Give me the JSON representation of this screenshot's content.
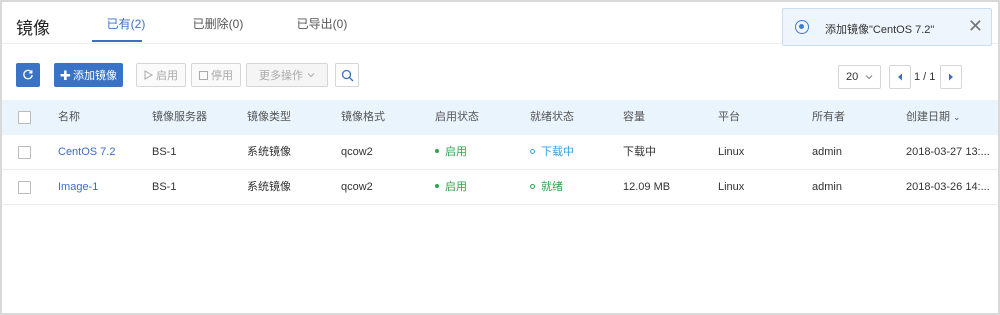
{
  "page": {
    "title": "镜像"
  },
  "tabs": [
    {
      "label": "已有(2)",
      "active": true
    },
    {
      "label": "已删除(0)",
      "active": false
    },
    {
      "label": "已导出(0)",
      "active": false
    }
  ],
  "notification": {
    "text": "添加镜像\"CentOS 7.2\"",
    "close": "✕"
  },
  "toolbar": {
    "add_label": "添加镜像",
    "enable_label": "启用",
    "disable_label": "停用",
    "more_label": "更多操作"
  },
  "pagination": {
    "page_size": "20",
    "page_info": "1 / 1"
  },
  "table": {
    "headers": [
      "名称",
      "镜像服务器",
      "镜像类型",
      "镜像格式",
      "启用状态",
      "就绪状态",
      "容量",
      "平台",
      "所有者",
      "创建日期"
    ],
    "rows": [
      {
        "name": "CentOS 7.2",
        "server": "BS-1",
        "type": "系统镜像",
        "format": "qcow2",
        "enable_state": "启用",
        "ready_state": "下载中",
        "size": "下载中",
        "platform": "Linux",
        "owner": "admin",
        "created": "2018-03-27 13:..."
      },
      {
        "name": "Image-1",
        "server": "BS-1",
        "type": "系统镜像",
        "format": "qcow2",
        "enable_state": "启用",
        "ready_state": "就绪",
        "size": "12.09 MB",
        "platform": "Linux",
        "owner": "admin",
        "created": "2018-03-26 14:..."
      }
    ]
  },
  "colors": {
    "primary": "#3a73c6",
    "success": "#2ea44f",
    "info": "#3aa0e0",
    "header_bg": "#eaf4fd"
  }
}
